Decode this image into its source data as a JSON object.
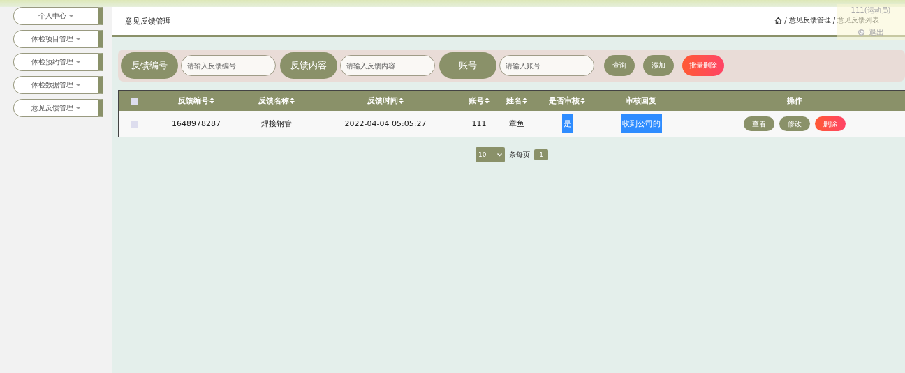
{
  "sidebar": {
    "items": [
      {
        "label": "个人中心",
        "expanded": false
      },
      {
        "label": "体检项目管理",
        "expanded": false
      },
      {
        "label": "体检预约管理",
        "expanded": false
      },
      {
        "label": "体检数据管理",
        "expanded": false
      },
      {
        "label": "意见反馈管理",
        "expanded": false
      }
    ]
  },
  "header": {
    "title": "意见反馈管理",
    "separator": "/",
    "breadcrumb": [
      "意见反馈管理",
      "意见反馈列表"
    ]
  },
  "user_menu": {
    "user": "111(运动员)",
    "logout": "退出"
  },
  "search": {
    "fields": [
      {
        "label": "反馈编号",
        "placeholder": "请输入反馈编号"
      },
      {
        "label": "反馈内容",
        "placeholder": "请输入反馈内容"
      },
      {
        "label": "账号",
        "placeholder": "请输入账号"
      }
    ],
    "buttons": [
      {
        "label": "查询",
        "kind": "normal"
      },
      {
        "label": "添加",
        "kind": "normal"
      },
      {
        "label": "批量删除",
        "kind": "danger"
      }
    ]
  },
  "table": {
    "columns": [
      {
        "label": "反馈编号",
        "sortable": true
      },
      {
        "label": "反馈名称",
        "sortable": true
      },
      {
        "label": "反馈时间",
        "sortable": true
      },
      {
        "label": "账号",
        "sortable": true
      },
      {
        "label": "姓名",
        "sortable": true
      },
      {
        "label": "是否审核",
        "sortable": true
      },
      {
        "label": "审核回复",
        "sortable": false
      },
      {
        "label": "操作",
        "sortable": false
      }
    ],
    "header_checked": false,
    "rows": [
      {
        "checked": false,
        "cells": [
          {
            "text": "1648978287",
            "highlighted": false
          },
          {
            "text": "焊接钢管",
            "highlighted": false
          },
          {
            "text": "2022-04-04 05:05:27",
            "highlighted": false
          },
          {
            "text": "111",
            "highlighted": false
          },
          {
            "text": "章鱼",
            "highlighted": false
          },
          {
            "text": "是",
            "highlighted": true
          },
          {
            "text": "收到公司的",
            "highlighted": true
          }
        ],
        "actions": [
          {
            "label": "查看",
            "kind": "normal"
          },
          {
            "label": "修改",
            "kind": "normal"
          },
          {
            "label": "删除",
            "kind": "danger"
          }
        ]
      }
    ]
  },
  "pagination": {
    "page_size": "10",
    "per_page_label": "条每页",
    "pages": [
      {
        "label": "1",
        "selected": true
      }
    ]
  }
}
